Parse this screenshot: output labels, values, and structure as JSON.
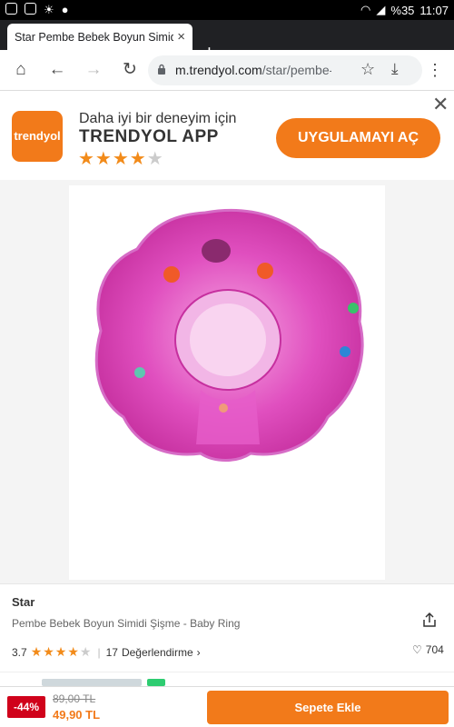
{
  "status_bar": {
    "battery": "%35",
    "time": "11:07"
  },
  "browser": {
    "tab_title": "Star Pembe Bebek Boyun Simidi Şişme - Baby Ring",
    "new_tab": "+",
    "url_host": "m.trendyol.com",
    "url_path": "/star/pembe-bebek-boyun-simidi"
  },
  "banner": {
    "logo_text": "trendyol",
    "line1": "Daha iyi bir deneyim için",
    "line2": "TRENDYOL APP",
    "rating": 4.5,
    "cta": "UYGULAMAYI AÇ",
    "accent": "#f27a1a"
  },
  "product": {
    "brand": "Star",
    "name": "Pembe Bebek Boyun Simidi Şişme - Baby Ring",
    "rating_value": "3.7",
    "review_count": "17",
    "reviews_label": "Değerlendirme",
    "favorites": "704",
    "image_color": "#e04fbf"
  },
  "bottom_bar": {
    "discount": "-44%",
    "old_price": "89,00 TL",
    "new_price": "49,90 TL",
    "add_to_cart": "Sepete Ekle"
  }
}
